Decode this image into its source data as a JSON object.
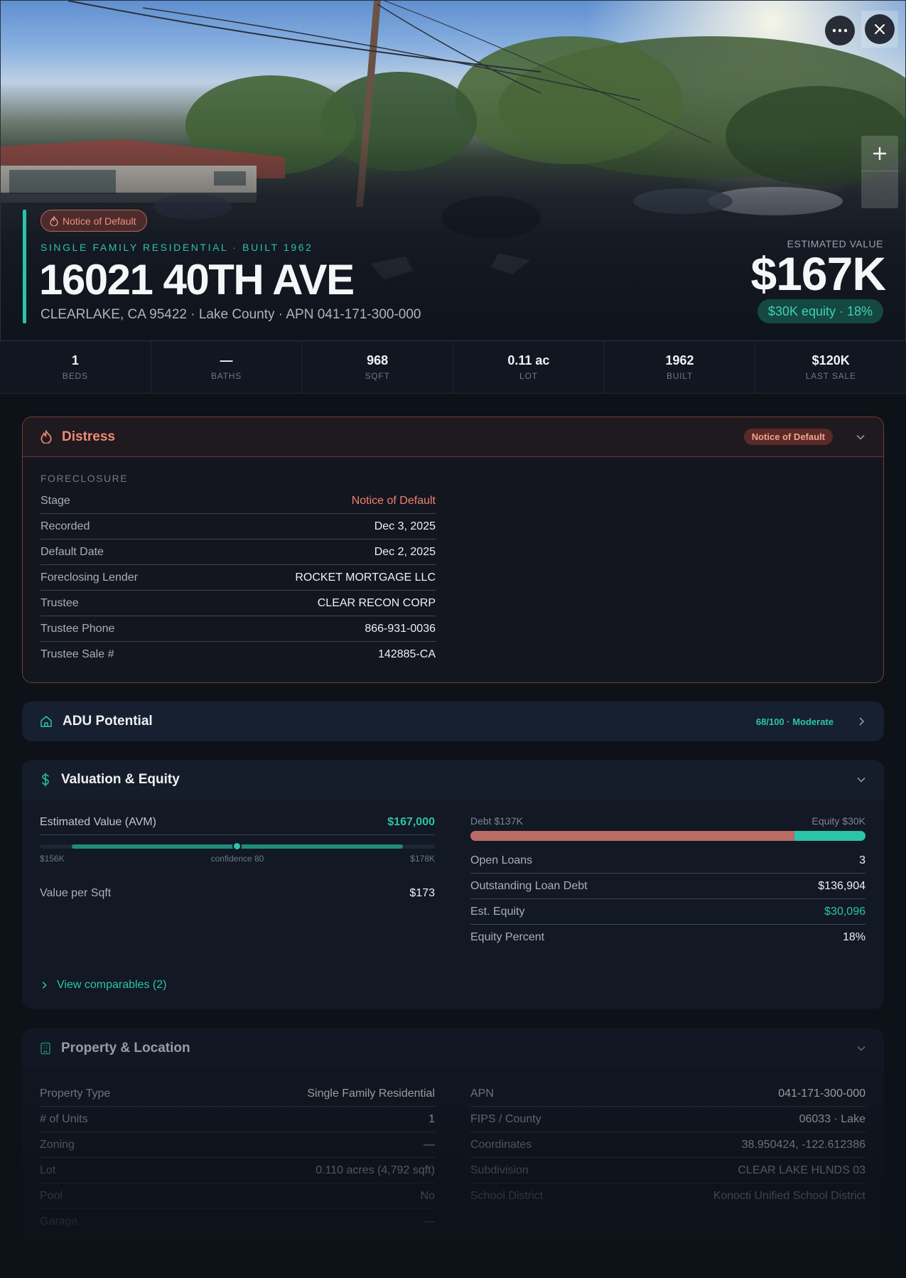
{
  "hero": {
    "distress_badge": "Notice of Default",
    "property_line": "SINGLE FAMILY RESIDENTIAL · BUILT 1962",
    "address": "16021 40TH AVE",
    "subline": "CLEARLAKE, CA 95422 · Lake County · APN 041-171-300-000",
    "estimated_label": "ESTIMATED VALUE",
    "estimated_value": "$167K",
    "equity_pill": "$30K equity · 18%"
  },
  "stats": [
    {
      "value": "1",
      "label": "BEDS"
    },
    {
      "value": "—",
      "label": "BATHS"
    },
    {
      "value": "968",
      "label": "SQFT"
    },
    {
      "value": "0.11 ac",
      "label": "LOT"
    },
    {
      "value": "1962",
      "label": "BUILT"
    },
    {
      "value": "$120K",
      "label": "LAST SALE"
    }
  ],
  "distress": {
    "title": "Distress",
    "badge": "Notice of Default",
    "section": "FORECLOSURE",
    "rows": [
      {
        "k": "Stage",
        "v": "Notice of Default"
      },
      {
        "k": "Recorded",
        "v": "Dec 3, 2025"
      },
      {
        "k": "Default Date",
        "v": "Dec 2, 2025"
      },
      {
        "k": "Foreclosing Lender",
        "v": "ROCKET MORTGAGE LLC"
      },
      {
        "k": "Trustee",
        "v": "CLEAR RECON CORP"
      },
      {
        "k": "Trustee Phone",
        "v": "866-931-0036"
      },
      {
        "k": "Trustee Sale #",
        "v": "142885-CA"
      }
    ]
  },
  "adu": {
    "title": "ADU Potential",
    "score": "68/100 · Moderate"
  },
  "valuation": {
    "title": "Valuation & Equity",
    "avm_label": "Estimated Value (AVM)",
    "avm_value": "$167,000",
    "range_low": "$156K",
    "range_high": "$178K",
    "confidence": "confidence 80",
    "vps_label": "Value per Sqft",
    "vps_value": "$173",
    "debt_label": "Debt $137K",
    "equity_label": "Equity $30K",
    "debt_share": 0.82,
    "rows": [
      {
        "k": "Open Loans",
        "v": "3"
      },
      {
        "k": "Outstanding Loan Debt",
        "v": "$136,904"
      },
      {
        "k": "Est. Equity",
        "v": "$30,096"
      },
      {
        "k": "Equity Percent",
        "v": "18%"
      }
    ],
    "comparables": "View comparables (2)"
  },
  "property": {
    "title": "Property & Location",
    "left": [
      {
        "k": "Property Type",
        "v": "Single Family Residential"
      },
      {
        "k": "# of Units",
        "v": "1"
      },
      {
        "k": "Zoning",
        "v": "—"
      },
      {
        "k": "Lot",
        "v": "0.110 acres (4,792 sqft)"
      },
      {
        "k": "Pool",
        "v": "No"
      },
      {
        "k": "Garage",
        "v": "—"
      }
    ],
    "right": [
      {
        "k": "APN",
        "v": "041-171-300-000"
      },
      {
        "k": "FIPS / County",
        "v": "06033 · Lake"
      },
      {
        "k": "Coordinates",
        "v": "38.950424, -122.612386"
      },
      {
        "k": "Subdivision",
        "v": "CLEAR LAKE HLNDS 03"
      },
      {
        "k": "School District",
        "v": "Konocti Unified School District"
      }
    ]
  },
  "colors": {
    "accent": "#2bc4a9",
    "distress": "#ef8a78",
    "debt": "#b86c63",
    "background": "#0d1118"
  },
  "icons": [
    "more-icon",
    "close-icon",
    "plus-icon",
    "flame-icon",
    "chevron-down-icon",
    "home-icon",
    "chevron-right-icon",
    "dollar-icon",
    "building-icon"
  ]
}
